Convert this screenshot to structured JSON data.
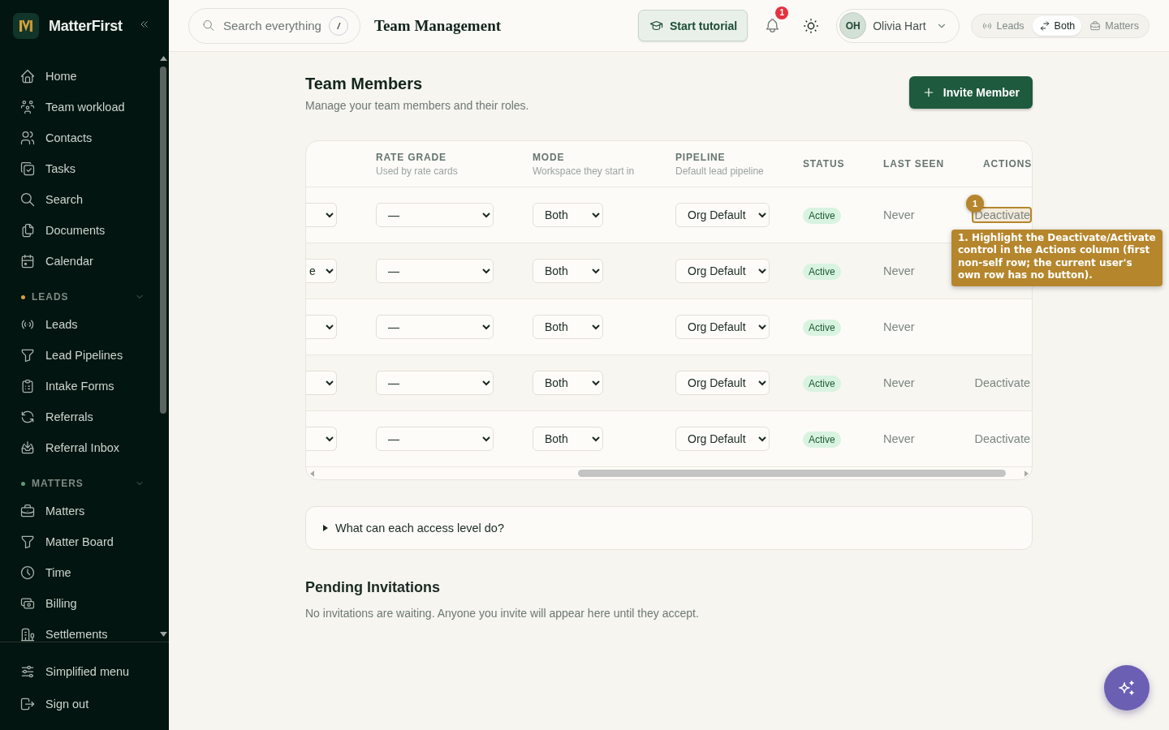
{
  "sidebar": {
    "brand": "MatterFirst",
    "groups": [
      {
        "items": [
          "Home",
          "Team workload",
          "Contacts",
          "Tasks",
          "Search",
          "Documents",
          "Calendar"
        ]
      },
      {
        "title": "LEADS",
        "color": "#d4a23c",
        "expanded": true,
        "items": [
          "Leads",
          "Lead Pipelines",
          "Intake Forms",
          "Referrals",
          "Referral Inbox"
        ]
      },
      {
        "title": "MATTERS",
        "color": "#5f9a7d",
        "expanded": true,
        "items": [
          "Matters",
          "Matter Board",
          "Time",
          "Billing",
          "Settlements"
        ]
      }
    ],
    "footer": [
      "Simplified menu",
      "Sign out"
    ]
  },
  "header": {
    "search": {
      "placeholder": "Search everything",
      "shortcut": "/"
    },
    "page_title": "Team Management",
    "tutorial_button": "Start tutorial",
    "notifications": {
      "count": "1"
    },
    "user": {
      "initials": "OH",
      "name": "Olivia Hart"
    },
    "mode_switch": [
      {
        "label": "Leads",
        "selected": false
      },
      {
        "label": "Both",
        "selected": true
      },
      {
        "label": "Matters",
        "selected": false
      }
    ]
  },
  "team_members": {
    "title": "Team Members",
    "subtitle": "Manage your team members and their roles.",
    "invite_button": "Invite Member",
    "table": {
      "columns": [
        {
          "title": "RATE GRADE",
          "subtitle": "Used by rate cards"
        },
        {
          "title": "MODE",
          "subtitle": "Workspace they start in"
        },
        {
          "title": "PIPELINE",
          "subtitle": "Default lead pipeline"
        },
        {
          "title": "STATUS"
        },
        {
          "title": "LAST SEEN"
        },
        {
          "title": "ACTIONS"
        }
      ],
      "rows": [
        {
          "rate_grade": "—",
          "mode": "Both",
          "pipeline": "Org Default",
          "status": {
            "label": "Active",
            "kind": "active"
          },
          "last_seen": "Never",
          "action": {
            "label": "Deactivate",
            "highlighted": true
          }
        },
        {
          "column_1": "e",
          "rate_grade": "—",
          "mode": "Both",
          "pipeline": "Org Default",
          "status": {
            "label": "Active",
            "kind": "active"
          },
          "last_seen": "Never"
        },
        {
          "rate_grade": "—",
          "mode": "Both",
          "pipeline": "Org Default",
          "status": {
            "label": "Active",
            "kind": "active"
          },
          "last_seen": "Never"
        },
        {
          "rate_grade": "—",
          "mode": "Both",
          "pipeline": "Org Default",
          "status": {
            "label": "Active",
            "kind": "active"
          },
          "last_seen": "Never",
          "action": {
            "label": "Deactivate",
            "highlighted": false
          }
        },
        {
          "rate_grade": "—",
          "mode": "Both",
          "pipeline": "Org Default",
          "status": {
            "label": "Active",
            "kind": "active"
          },
          "last_seen": "Never",
          "action": {
            "label": "Deactivate",
            "highlighted": false
          }
        }
      ]
    }
  },
  "tutorial_overlay": {
    "step": "1",
    "text": "1. Highlight the Deactivate/Activate control in the Actions column (first non-self row; the current user's own row has no button)."
  },
  "access_levels": {
    "summary": "What can each access level do?",
    "expanded": false
  },
  "pending_invitations": {
    "title": "Pending Invitations",
    "empty_text": "No invitations are waiting. Anyone you invite will appear here until they accept."
  }
}
